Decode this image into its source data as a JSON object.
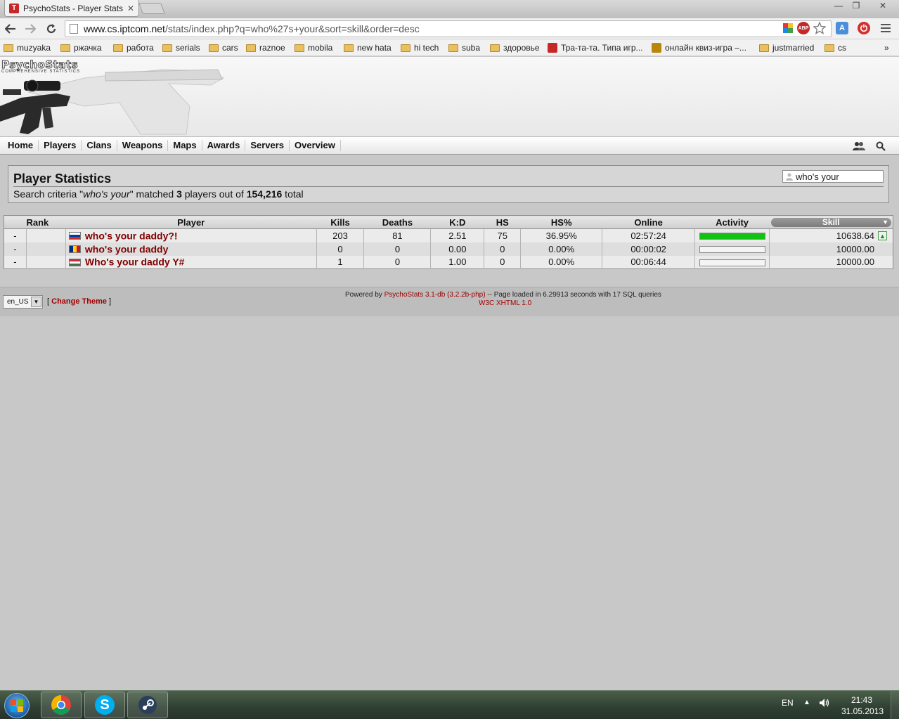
{
  "browser": {
    "tab_title": "PsychoStats - Player Stats",
    "tab_favicon_letter": "T",
    "url_host": "www.cs.iptcom.net",
    "url_path": "/stats/index.php?q=who%27s+your&sort=skill&order=desc",
    "minimize": "—",
    "maximize": "❐",
    "close": "✕",
    "ext_abp": "ABP"
  },
  "bookmarks": [
    {
      "label": "muzyaka"
    },
    {
      "label": "ржачка"
    },
    {
      "label": "работа"
    },
    {
      "label": "serials"
    },
    {
      "label": "cars"
    },
    {
      "label": "raznoe"
    },
    {
      "label": "mobila"
    },
    {
      "label": "new hata"
    },
    {
      "label": "hi tech"
    },
    {
      "label": "suba"
    },
    {
      "label": "здоровье"
    },
    {
      "label": "Тра-та-та. Типа игр..."
    },
    {
      "label": "онлайн квиз-игра –..."
    },
    {
      "label": "justmarried"
    },
    {
      "label": "cs"
    }
  ],
  "bookmarks_more": "»",
  "site": {
    "logo": "PsychoStats",
    "logo_sub": "COMPREHENSIVE STATISTICS"
  },
  "nav": [
    "Home",
    "Players",
    "Clans",
    "Weapons",
    "Maps",
    "Awards",
    "Servers",
    "Overview"
  ],
  "stats": {
    "title": "Player Statistics",
    "info_prefix": "Search criteria \"",
    "query": "who's your",
    "info_mid": "\" matched ",
    "matched": "3",
    "info_mid2": " players out of ",
    "total": "154,216",
    "info_suffix": " total",
    "search_value": "who's your"
  },
  "table": {
    "headers": [
      "Rank",
      "Player",
      "Kills",
      "Deaths",
      "K:D",
      "HS",
      "HS%",
      "Online",
      "Activity",
      "Skill"
    ],
    "sort_indicator": "▼",
    "trend_up": "▲",
    "rows": [
      {
        "rank": "-",
        "name": "who's your daddy?!",
        "flag": "ru",
        "kills": "203",
        "deaths": "81",
        "kd": "2.51",
        "hs": "75",
        "hs_pct": "36.95%",
        "online": "02:57:24",
        "activity": 100,
        "skill": "10638.64",
        "trend": true
      },
      {
        "rank": "-",
        "name": "who's your daddy",
        "flag": "ro",
        "kills": "0",
        "deaths": "0",
        "kd": "0.00",
        "hs": "0",
        "hs_pct": "0.00%",
        "online": "00:00:02",
        "activity": 0,
        "skill": "10000.00",
        "trend": false
      },
      {
        "rank": "-",
        "name": "Who's your daddy Y#",
        "flag": "hu",
        "kills": "1",
        "deaths": "0",
        "kd": "1.00",
        "hs": "0",
        "hs_pct": "0.00%",
        "online": "00:06:44",
        "activity": 0,
        "skill": "10000.00",
        "trend": false
      }
    ]
  },
  "footer": {
    "language": "en_US",
    "change_theme_open": "[ ",
    "change_theme": "Change Theme",
    "change_theme_close": " ]",
    "powered_prefix": "Powered by ",
    "powered_link": "PsychoStats 3.1-db (3.2.2b-php)",
    "powered_suffix": " -- Page loaded in 6.29913 seconds with 17 SQL queries",
    "w3c": "W3C XHTML 1.0"
  },
  "taskbar": {
    "lang": "EN",
    "tray_arrow": "▲",
    "time": "21:43",
    "date": "31.05.2013"
  },
  "colors": {
    "link_red": "#800000",
    "activity_green": "#12c212"
  }
}
